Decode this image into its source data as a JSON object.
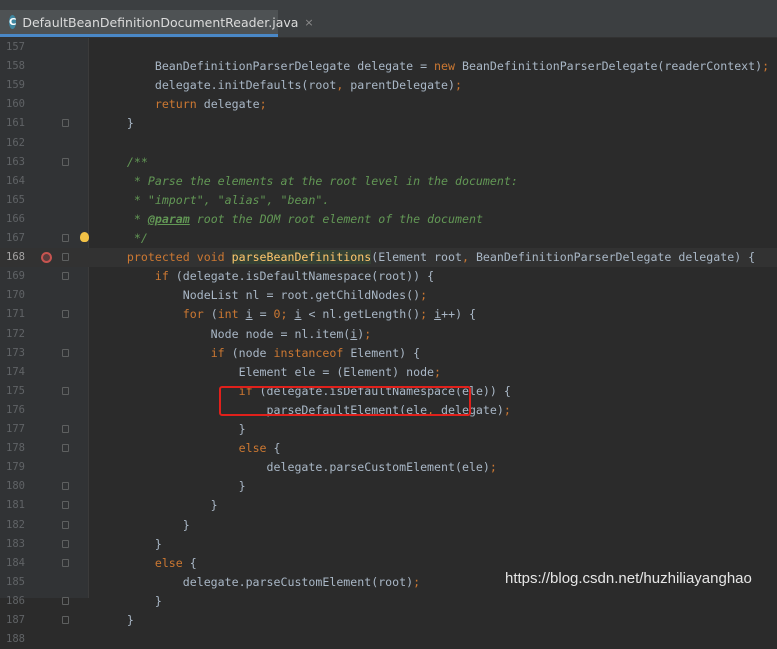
{
  "tab": {
    "title": "DefaultBeanDefinitionDocumentReader.java",
    "icon_letter": "C",
    "close_glyph": "×"
  },
  "watermark": "https://blog.csdn.net/huzhiliayanghao",
  "colors": {
    "background": "#2b2b2b",
    "keyword": "#cc7832",
    "comment": "#629755",
    "method_declaration": "#ffc66d",
    "highlight_box": "#e0201b"
  },
  "lines": [
    {
      "n": "157",
      "segs": []
    },
    {
      "n": "158",
      "segs": [
        [
          "t",
          "        BeanDefinitionParserDelegate delegate = "
        ],
        [
          "kw",
          "new"
        ],
        [
          "t",
          " BeanDefinitionParserDelegate(readerContext)"
        ],
        [
          "kw",
          ";"
        ]
      ]
    },
    {
      "n": "159",
      "segs": [
        [
          "t",
          "        delegate.initDefaults(root"
        ],
        [
          "kw",
          ","
        ],
        [
          "t",
          " parentDelegate)"
        ],
        [
          "kw",
          ";"
        ]
      ]
    },
    {
      "n": "160",
      "segs": [
        [
          "t",
          "        "
        ],
        [
          "kw",
          "return"
        ],
        [
          "t",
          " delegate"
        ],
        [
          "kw",
          ";"
        ]
      ]
    },
    {
      "n": "161",
      "fold": true,
      "segs": [
        [
          "t",
          "    }"
        ]
      ]
    },
    {
      "n": "162",
      "segs": []
    },
    {
      "n": "163",
      "fold": true,
      "segs": [
        [
          "t",
          "    "
        ],
        [
          "cm",
          "/**"
        ]
      ]
    },
    {
      "n": "164",
      "segs": [
        [
          "t",
          "    "
        ],
        [
          "cm",
          " * Parse the elements at the root level in the document:"
        ]
      ]
    },
    {
      "n": "165",
      "segs": [
        [
          "t",
          "    "
        ],
        [
          "cm",
          " * \"import\", \"alias\", \"bean\"."
        ]
      ]
    },
    {
      "n": "166",
      "segs": [
        [
          "t",
          "    "
        ],
        [
          "cm",
          " * "
        ],
        [
          "ctag",
          "@param"
        ],
        [
          "cm",
          " root the DOM root element of the document"
        ]
      ]
    },
    {
      "n": "167",
      "fold": true,
      "bulb": true,
      "segs": [
        [
          "t",
          "    "
        ],
        [
          "cm",
          " */"
        ]
      ]
    },
    {
      "n": "168",
      "fold": true,
      "breakpoint": true,
      "current": true,
      "segs": [
        [
          "t",
          "    "
        ],
        [
          "kw",
          "protected void "
        ],
        [
          "md",
          "parseBeanDefinitions"
        ],
        [
          "t",
          "(Element root"
        ],
        [
          "kw",
          ","
        ],
        [
          "t",
          " BeanDefinitionParserDelegate delegate) {"
        ]
      ]
    },
    {
      "n": "169",
      "fold": true,
      "segs": [
        [
          "t",
          "        "
        ],
        [
          "kw",
          "if"
        ],
        [
          "t",
          " (delegate.isDefaultNamespace(root)) {"
        ]
      ]
    },
    {
      "n": "170",
      "segs": [
        [
          "t",
          "            NodeList nl = root.getChildNodes()"
        ],
        [
          "kw",
          ";"
        ]
      ]
    },
    {
      "n": "171",
      "fold": true,
      "segs": [
        [
          "t",
          "            "
        ],
        [
          "kw",
          "for"
        ],
        [
          "t",
          " ("
        ],
        [
          "kw",
          "int "
        ],
        [
          "u",
          "i"
        ],
        [
          "t",
          " = "
        ],
        [
          "kw",
          "0"
        ],
        [
          "kw",
          "; "
        ],
        [
          "u",
          "i"
        ],
        [
          "t",
          " < nl.getLength()"
        ],
        [
          "kw",
          "; "
        ],
        [
          "u",
          "i"
        ],
        [
          "t",
          "++) {"
        ]
      ]
    },
    {
      "n": "172",
      "segs": [
        [
          "t",
          "                Node node = nl.item("
        ],
        [
          "u",
          "i"
        ],
        [
          "t",
          ")"
        ],
        [
          "kw",
          ";"
        ]
      ]
    },
    {
      "n": "173",
      "fold": true,
      "segs": [
        [
          "t",
          "                "
        ],
        [
          "kw",
          "if"
        ],
        [
          "t",
          " (node "
        ],
        [
          "kw",
          "instanceof"
        ],
        [
          "t",
          " Element) {"
        ]
      ]
    },
    {
      "n": "174",
      "segs": [
        [
          "t",
          "                    Element ele = (Element) node"
        ],
        [
          "kw",
          ";"
        ]
      ]
    },
    {
      "n": "175",
      "fold": true,
      "segs": [
        [
          "t",
          "                    "
        ],
        [
          "kw",
          "if"
        ],
        [
          "t",
          " (delegate.isDefaultNamespace(ele)) {"
        ]
      ]
    },
    {
      "n": "176",
      "segs": [
        [
          "t",
          "                        parseDefaultElement(ele"
        ],
        [
          "kw",
          ","
        ],
        [
          "t",
          " delegate)"
        ],
        [
          "kw",
          ";"
        ]
      ]
    },
    {
      "n": "177",
      "fold": true,
      "segs": [
        [
          "t",
          "                    }"
        ]
      ]
    },
    {
      "n": "178",
      "fold": true,
      "segs": [
        [
          "t",
          "                    "
        ],
        [
          "kw",
          "else"
        ],
        [
          "t",
          " {"
        ]
      ]
    },
    {
      "n": "179",
      "segs": [
        [
          "t",
          "                        delegate.parseCustomElement(ele)"
        ],
        [
          "kw",
          ";"
        ]
      ]
    },
    {
      "n": "180",
      "fold": true,
      "segs": [
        [
          "t",
          "                    }"
        ]
      ]
    },
    {
      "n": "181",
      "fold": true,
      "segs": [
        [
          "t",
          "                }"
        ]
      ]
    },
    {
      "n": "182",
      "fold": true,
      "segs": [
        [
          "t",
          "            }"
        ]
      ]
    },
    {
      "n": "183",
      "fold": true,
      "segs": [
        [
          "t",
          "        }"
        ]
      ]
    },
    {
      "n": "184",
      "fold": true,
      "segs": [
        [
          "t",
          "        "
        ],
        [
          "kw",
          "else"
        ],
        [
          "t",
          " {"
        ]
      ]
    },
    {
      "n": "185",
      "segs": [
        [
          "t",
          "            delegate.parseCustomElement(root)"
        ],
        [
          "kw",
          ";"
        ]
      ]
    },
    {
      "n": "186",
      "fold": true,
      "segs": [
        [
          "t",
          "        }"
        ]
      ]
    },
    {
      "n": "187",
      "fold": true,
      "segs": [
        [
          "t",
          "    }"
        ]
      ]
    },
    {
      "n": "188",
      "segs": []
    }
  ]
}
